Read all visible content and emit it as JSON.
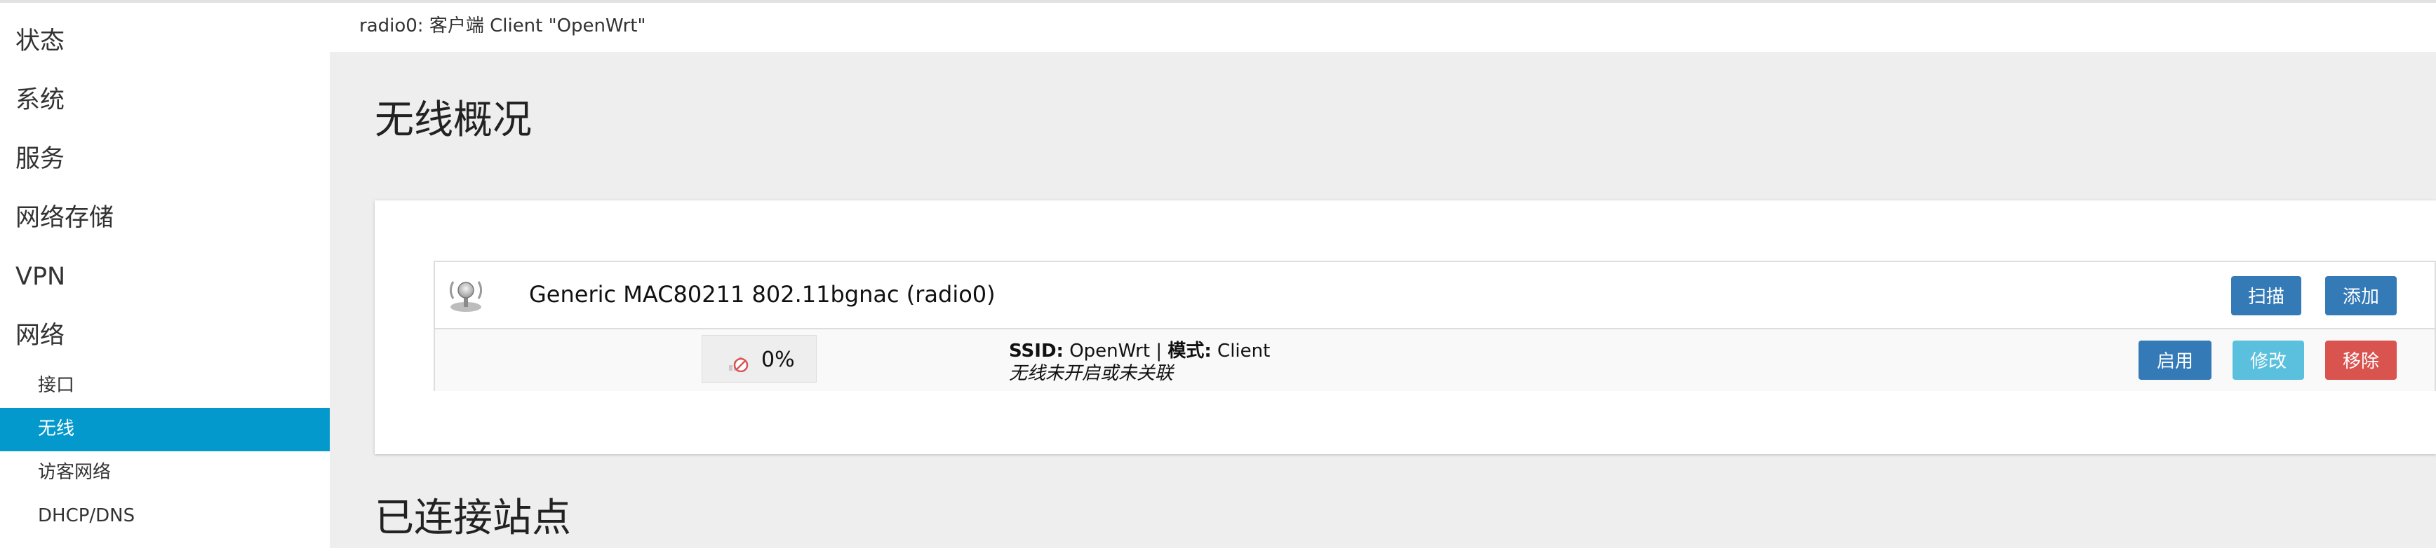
{
  "sidebar": {
    "items": [
      {
        "label": "状态"
      },
      {
        "label": "系统"
      },
      {
        "label": "服务"
      },
      {
        "label": "网络存储"
      },
      {
        "label": "VPN"
      },
      {
        "label": "网络"
      }
    ],
    "subitems": [
      {
        "label": "接口",
        "active": false
      },
      {
        "label": "无线",
        "active": true
      },
      {
        "label": "访客网络",
        "active": false
      },
      {
        "label": "DHCP/DNS",
        "active": false
      }
    ]
  },
  "notice": "radio0: 客户端 Client \"OpenWrt\"",
  "overview": {
    "title": "无线概况",
    "device": {
      "name": "Generic MAC80211 802.11bgnac (radio0)",
      "scan_label": "扫描",
      "add_label": "添加",
      "icon": "wireless-radio-icon"
    },
    "network": {
      "signal": "0%",
      "signal_icon": "signal-disabled-icon",
      "ssid_key": "SSID:",
      "ssid_value": " OpenWrt",
      "separator": " | ",
      "mode_key": "模式:",
      "mode_value": " Client",
      "status": "无线未开启或未关联",
      "enable_label": "启用",
      "edit_label": "修改",
      "remove_label": "移除"
    }
  },
  "stations": {
    "title": "已连接站点"
  },
  "colors": {
    "active_nav": "#0399cc",
    "primary_button": "#337ab7",
    "edit_button": "#5bc0de",
    "remove_button": "#d9534f"
  }
}
